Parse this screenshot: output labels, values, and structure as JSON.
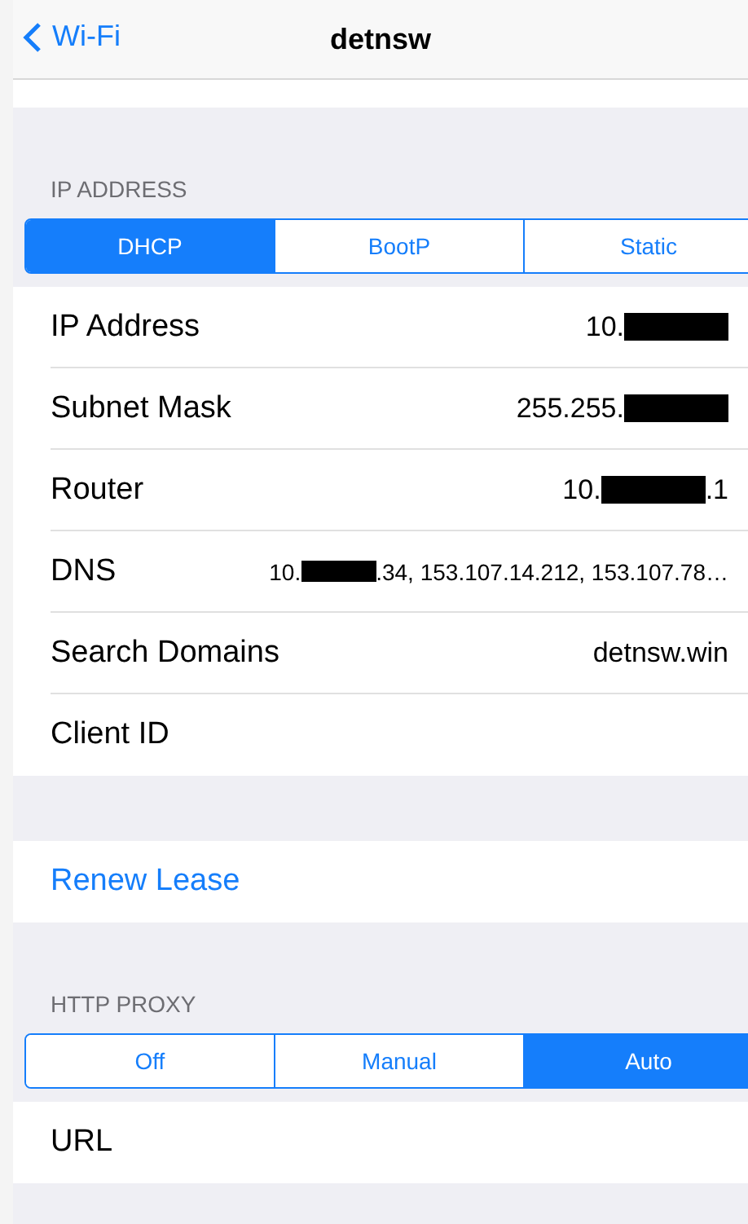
{
  "nav": {
    "back": "Wi-Fi",
    "title": "detnsw"
  },
  "ip_section": {
    "header": "IP ADDRESS",
    "modes": [
      {
        "label": "DHCP",
        "selected": true
      },
      {
        "label": "BootP",
        "selected": false
      },
      {
        "label": "Static",
        "selected": false
      }
    ],
    "rows": [
      {
        "label": "IP Address",
        "small": false,
        "value": [
          {
            "kind": "text",
            "text": "10."
          },
          {
            "kind": "redacted"
          }
        ]
      },
      {
        "label": "Subnet Mask",
        "small": false,
        "value": [
          {
            "kind": "text",
            "text": "255.255."
          },
          {
            "kind": "redacted"
          }
        ]
      },
      {
        "label": "Router",
        "small": false,
        "value": [
          {
            "kind": "text",
            "text": "10."
          },
          {
            "kind": "redacted"
          },
          {
            "kind": "text",
            "text": ".1"
          }
        ]
      },
      {
        "label": "DNS",
        "small": true,
        "value": [
          {
            "kind": "text",
            "text": "10."
          },
          {
            "kind": "redacted"
          },
          {
            "kind": "text",
            "text": ".34, 153.107.14.212, 153.107.78…"
          }
        ]
      },
      {
        "label": "Search Domains",
        "small": false,
        "value": [
          {
            "kind": "text",
            "text": "detnsw.win"
          }
        ]
      },
      {
        "label": "Client ID",
        "value": []
      }
    ]
  },
  "renew": "Renew Lease",
  "proxy_section": {
    "header": "HTTP PROXY",
    "modes": [
      {
        "label": "Off",
        "selected": false
      },
      {
        "label": "Manual",
        "selected": false
      },
      {
        "label": "Auto",
        "selected": true
      }
    ],
    "rows": [
      {
        "label": "URL"
      }
    ]
  }
}
